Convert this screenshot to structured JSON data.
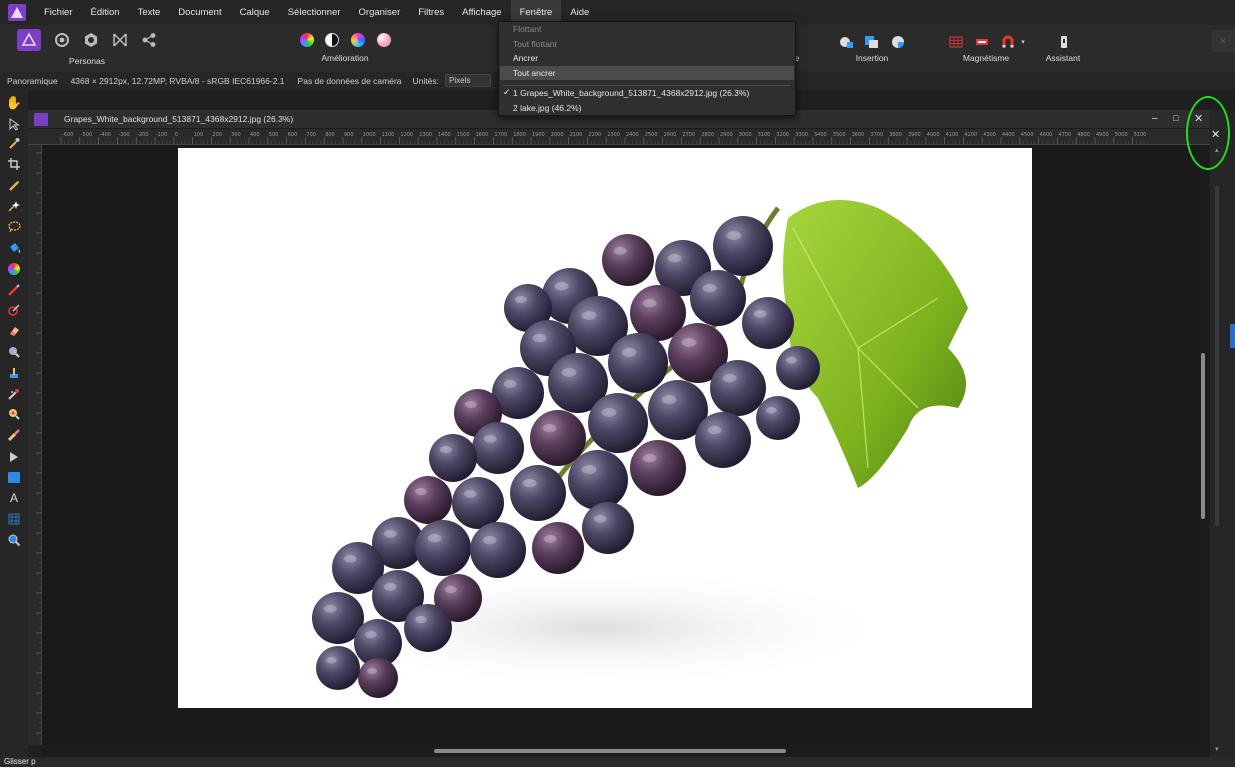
{
  "menubar": {
    "items": [
      "Fichier",
      "Édition",
      "Texte",
      "Document",
      "Calque",
      "Sélectionner",
      "Organiser",
      "Filtres",
      "Affichage",
      "Fenêtre",
      "Aide"
    ],
    "active": "Fenêtre"
  },
  "toolbar": {
    "personas_label": "Personas",
    "amelioration_label": "Amélioration",
    "insertion_label": "Insertion",
    "magnetisme_label": "Magnétisme",
    "assistant_label": "Assistant",
    "partial_label": "e"
  },
  "contextbar": {
    "tool": "Panoramique",
    "info": "4368 × 2912px, 12.72MP, RVBA/8 - sRGB IEC61966-2.1",
    "camera": "Pas de données de caméra",
    "units_label": "Unités:",
    "units_value": "Pixels"
  },
  "dropdown": {
    "items": [
      {
        "label": "Flottant",
        "disabled": true
      },
      {
        "label": "Tout flottant",
        "disabled": true
      },
      {
        "label": "Ancrer",
        "disabled": false
      },
      {
        "label": "Tout ancrer",
        "disabled": false,
        "highlighted": true
      }
    ],
    "documents": [
      {
        "label": "1 Grapes_White_background_513871_4368x2912.jpg (26.3%)",
        "checked": true
      },
      {
        "label": "2 lake.jpg (46.2%)",
        "checked": false
      }
    ]
  },
  "document": {
    "title": "Grapes_White_background_513871_4368x2912.jpg (26.3%)"
  },
  "ruler": {
    "h_ticks": [
      "-600",
      "-500",
      "-400",
      "-300",
      "-200",
      "-100",
      "0",
      "100",
      "200",
      "300",
      "400",
      "500",
      "600",
      "700",
      "800",
      "900",
      "1000",
      "1100",
      "1200",
      "1300",
      "1400",
      "1500",
      "1600",
      "1700",
      "1800",
      "1900",
      "2000",
      "2100",
      "2200",
      "2300",
      "2400",
      "2500",
      "2600",
      "2700",
      "2800",
      "2900",
      "3000",
      "3100",
      "3200",
      "3300",
      "3400",
      "3500",
      "3600",
      "3700",
      "3800",
      "3900",
      "4000",
      "4100",
      "4200",
      "4300",
      "4400",
      "4500",
      "4600",
      "4700",
      "4800",
      "4900",
      "5000",
      "5100"
    ]
  },
  "status": {
    "text": "Glisser p"
  },
  "colors": {
    "accent": "#7b3fc6",
    "highlight_circle": "#22dd22"
  }
}
